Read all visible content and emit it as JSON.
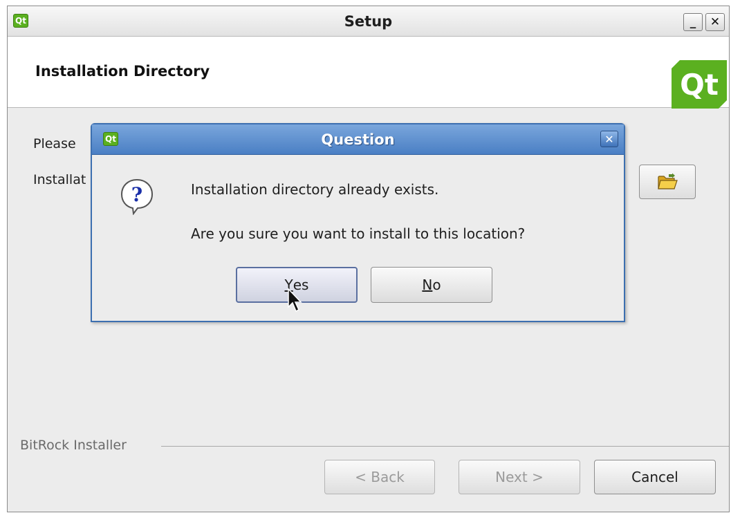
{
  "window": {
    "title": "Setup",
    "app_icon_text": "Qt",
    "minimize_glyph": "_",
    "close_glyph": "✕"
  },
  "header": {
    "title": "Installation Directory",
    "logo_text": "Qt"
  },
  "body": {
    "prompt_partial": "Please",
    "field_label_partial": "Installat",
    "browse_icon": "folder-open-icon"
  },
  "footer": {
    "brand": "BitRock Installer",
    "back_label": "< Back",
    "next_label": "Next >",
    "cancel_label": "Cancel"
  },
  "dialog": {
    "title": "Question",
    "icon_text": "Qt",
    "close_glyph": "✕",
    "question_icon": "question-bubble-icon",
    "message_line1": "Installation directory already exists.",
    "message_line2": "Are you sure you want to install to this location?",
    "yes_mnemonic": "Y",
    "yes_rest": "es",
    "no_mnemonic": "N",
    "no_rest": "o"
  },
  "colors": {
    "qt_green": "#5bb020",
    "dialog_blue": "#4a7fc4"
  }
}
